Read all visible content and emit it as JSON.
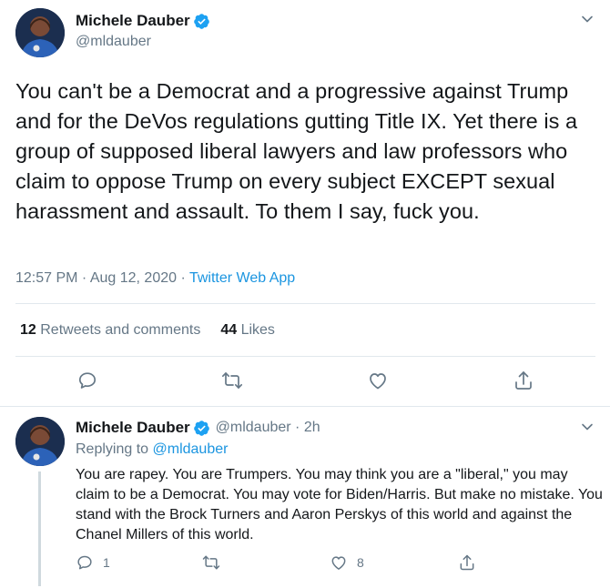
{
  "main_tweet": {
    "display_name": "Michele Dauber",
    "handle": "@mldauber",
    "text": "You can't be a Democrat and a progressive against Trump and for the DeVos regulations gutting Title IX. Yet there is a group of supposed liberal lawyers and law professors who claim to oppose Trump on every subject EXCEPT sexual harassment and assault. To them I say, fuck you.",
    "time": "12:57 PM · Aug 12, 2020 · ",
    "source": "Twitter Web App",
    "retweets_count": "12",
    "retweets_label": "Retweets and comments",
    "likes_count": "44",
    "likes_label": "Likes"
  },
  "reply_tweet": {
    "display_name": "Michele Dauber",
    "handle_time": "@mldauber · 2h",
    "replying_label": "Replying to ",
    "replying_mention": "@mldauber",
    "text": "You are rapey. You are Trumpers. You may think you are a \"liberal,\" you may claim to be a Democrat. You may vote for Biden/Harris. But make no mistake. You stand with the Brock Turners and Aaron Perskys of this world and against the Chanel Millers of this world.",
    "reply_count": "1",
    "like_count": "8"
  },
  "icons": [
    "verified-badge-icon",
    "caret-down-icon",
    "reply-icon",
    "retweet-icon",
    "like-icon",
    "share-icon"
  ],
  "colors": {
    "primary_text": "#14171a",
    "secondary_text": "#657786",
    "link": "#1b95e0",
    "divider": "#e1e8ed"
  }
}
